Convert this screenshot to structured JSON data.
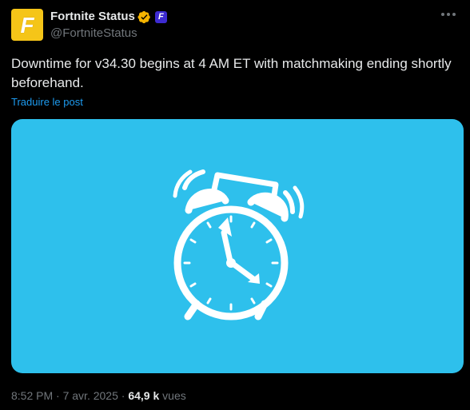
{
  "account": {
    "display_name": "Fortnite Status",
    "handle": "@FortniteStatus",
    "avatar_letter": "F",
    "affiliate_badge_letter": "F",
    "avatar_color": "#f5c518",
    "verified_color": "#f5b400",
    "affiliate_color": "#3d2bd1"
  },
  "tweet": {
    "text": "Downtime for v34.30 begins at 4 AM ET with matchmaking ending shortly beforehand.",
    "translate_label": "Traduire le post",
    "media_background": "#2ec0ec",
    "media_icon": "alarm-clock-icon"
  },
  "meta": {
    "time": "8:52 PM",
    "separator": "·",
    "date": "7 avr. 2025",
    "views_count": "64,9 k",
    "views_label": "vues"
  },
  "icons": {
    "more": "more-options-icon",
    "verified": "verified-badge-icon",
    "affiliate": "affiliate-badge-icon"
  }
}
